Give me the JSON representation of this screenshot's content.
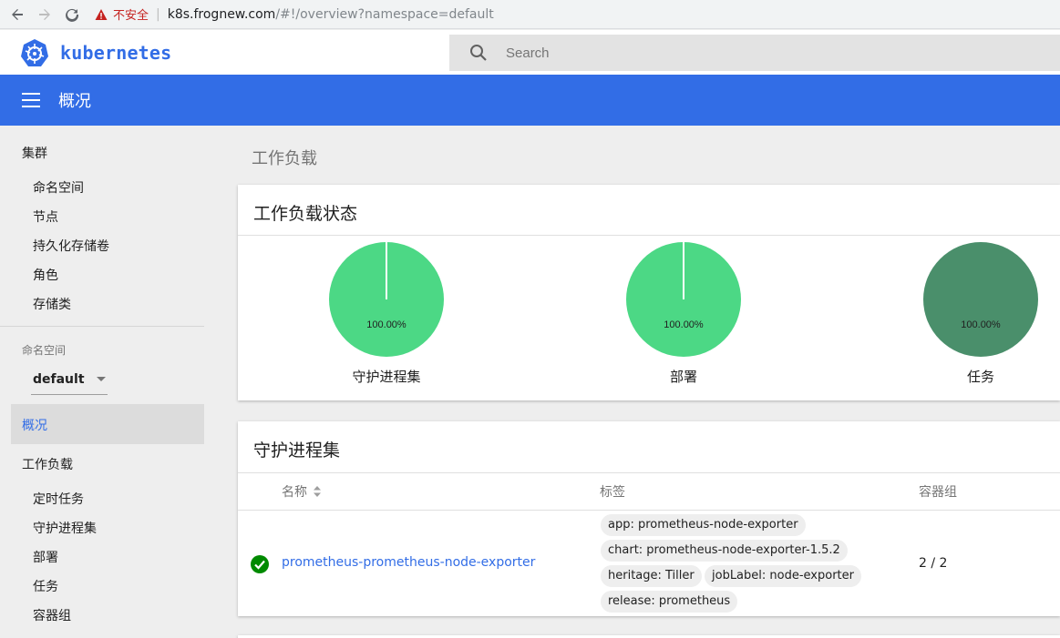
{
  "browser": {
    "security_label": "不安全",
    "url_host": "k8s.frognew.com",
    "url_path": "/#!/overview?namespace=default"
  },
  "header": {
    "brand": "kubernetes",
    "search_placeholder": "Search"
  },
  "toolbar": {
    "title": "概况"
  },
  "sidebar": {
    "cluster_title": "集群",
    "cluster_items": [
      "命名空间",
      "节点",
      "持久化存储卷",
      "角色",
      "存储类"
    ],
    "namespace_label": "命名空间",
    "namespace_value": "default",
    "overview_label": "概况",
    "workloads_title": "工作负载",
    "workload_items": [
      "定时任务",
      "守护进程集",
      "部署",
      "任务",
      "容器组"
    ]
  },
  "main": {
    "heading": "工作负载",
    "status_card": {
      "title": "工作负载状态",
      "charts": [
        {
          "label": "守护进程集",
          "percent": "100.00%",
          "running_fraction": 1.0,
          "color": "#4cd885"
        },
        {
          "label": "部署",
          "percent": "100.00%",
          "running_fraction": 1.0,
          "color": "#4cd885"
        },
        {
          "label": "任务",
          "percent": "100.00%",
          "running_fraction": 1.0,
          "color": "#4a8f6b"
        }
      ]
    },
    "daemonset_card": {
      "title": "守护进程集",
      "columns": {
        "name": "名称",
        "labels": "标签",
        "pods": "容器组"
      },
      "rows": [
        {
          "name": "prometheus-prometheus-node-exporter",
          "labels": [
            "app: prometheus-node-exporter",
            "chart: prometheus-node-exporter-1.5.2",
            "heritage: Tiller",
            "jobLabel: node-exporter",
            "release: prometheus"
          ],
          "pods": "2 / 2",
          "status": "running"
        }
      ]
    }
  },
  "colors": {
    "primary": "#326de6",
    "success": "#00a000",
    "warning": "#c5221f"
  }
}
